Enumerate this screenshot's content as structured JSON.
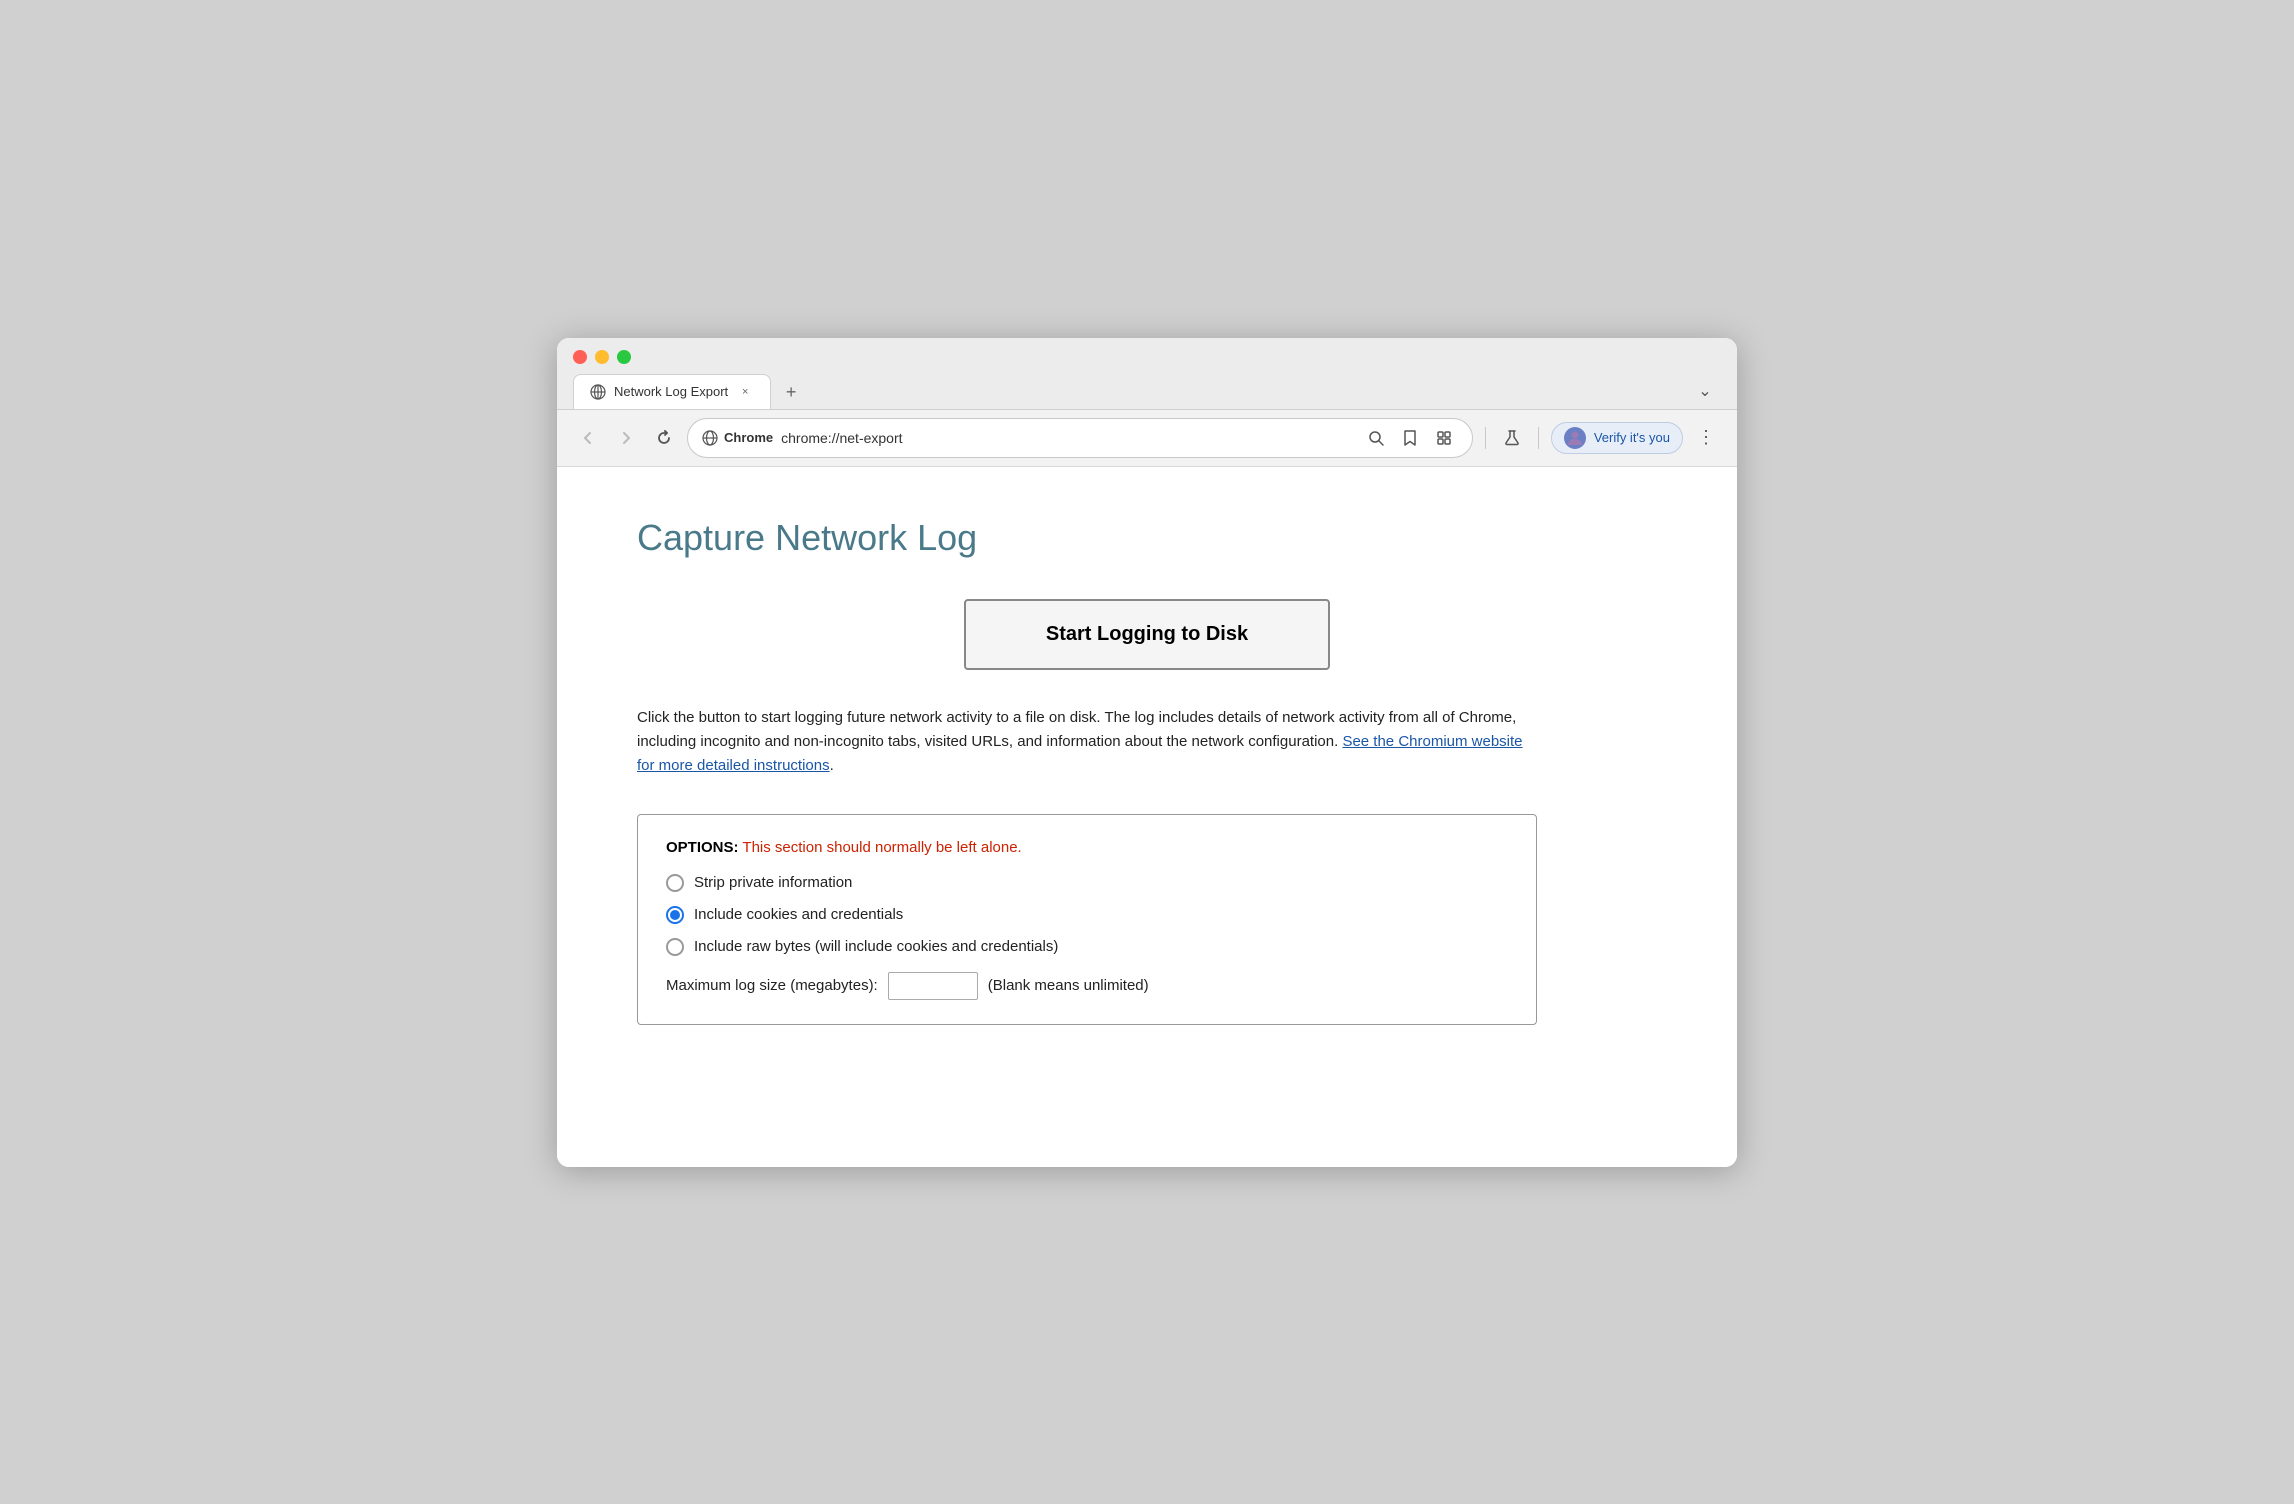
{
  "window": {
    "tab_title": "Network Log Export",
    "tab_close_label": "×",
    "tab_new_label": "+",
    "tab_dropdown_label": "⌄"
  },
  "toolbar": {
    "back_label": "←",
    "forward_label": "→",
    "reload_label": "↻",
    "address_prefix": "Chrome",
    "address_url": "chrome://net-export",
    "verify_label": "Verify it's you",
    "menu_label": "⋮"
  },
  "page": {
    "title": "Capture Network Log",
    "start_button": "Start Logging to Disk",
    "description_part1": "Click the button to start logging future network activity to a file on disk. The log includes details of network activity from all of Chrome, including incognito and non-incognito tabs, visited URLs, and information about the network configuration. ",
    "description_link": "See the Chromium website for more detailed instructions",
    "description_period": ".",
    "options_label": "OPTIONS:",
    "options_warning": " This section should normally be left alone.",
    "radio_strip": "Strip private information",
    "radio_cookies": "Include cookies and credentials",
    "radio_raw": "Include raw bytes (will include cookies and credentials)",
    "max_log_label": "Maximum log size (megabytes):",
    "max_log_hint": "(Blank means unlimited)",
    "max_log_value": ""
  }
}
